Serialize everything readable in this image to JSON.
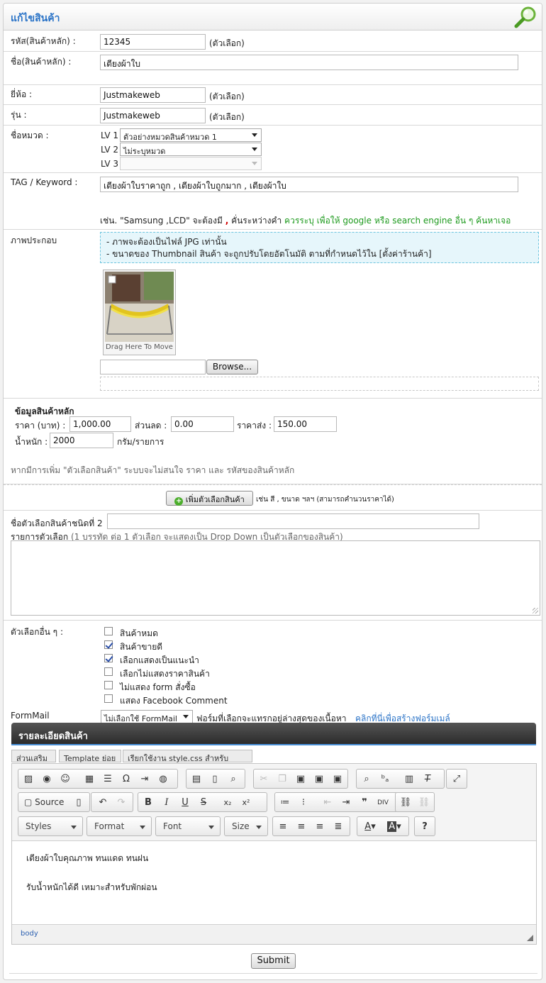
{
  "page": {
    "title": "แก้ไขสินค้า"
  },
  "product": {
    "code_label": "รหัส(สินค้าหลัก) :",
    "code_value": "12345",
    "optional": "(ตัวเลือก)",
    "name_label": "ชื่อ(สินค้าหลัก) :",
    "name_value": "เตียงผ้าใบ",
    "brand_label": "ยี่ห้อ :",
    "brand_value": "Justmakeweb",
    "model_label": "รุ่น :",
    "model_value": "Justmakeweb",
    "category_label": "ชื่อหมวด :",
    "lv1_label": "LV 1",
    "lv1_value": "ตัวอย่างหมวดสินค้าหมวด 1",
    "lv2_label": "LV 2",
    "lv2_value": "ไม่ระบุหมวด",
    "lv3_label": "LV 3",
    "lv3_value": "",
    "tag_label": "TAG / Keyword :",
    "tag_value": "เตียงผ้าใบราคาถูก , เตียงผ้าใบถูกมาก , เตียงผ้าใบ",
    "tag_hint_1": "เช่น. \"Samsung ,LCD\" จะต้องมี",
    "tag_hint_comma": ",",
    "tag_hint_2": "คั่นระหว่างคำ",
    "tag_hint_3": "ควรระบุ เพื่อให้ google หรือ search engine อื่น ๆ ค้นหาเจอ"
  },
  "image": {
    "label": "ภาพประกอบ",
    "info_1": "- ภาพจะต้องเป็นไฟล์ JPG เท่านั้น",
    "info_2": "- ขนาดของ Thumbnail สินค้า จะถูกปรับโดยอัตโนมัติ ตามที่กำหนดไว้ใน [ตั้งค่าร้านค้า]",
    "drag_caption": "Drag Here To Move",
    "file_value": "",
    "browse_label": "Browse..."
  },
  "main_data": {
    "heading": "ข้อมูลสินค้าหลัก",
    "price_label": "ราคา (บาท) :",
    "price_value": "1,000.00",
    "discount_label": "ส่วนลด :",
    "discount_value": "0.00",
    "wholesale_label": "ราคาส่ง :",
    "wholesale_value": "150.00",
    "weight_label": "น้ำหนัก :",
    "weight_value": "2000",
    "weight_unit": "กรัม/รายการ",
    "variant_note": "หากมีการเพิ่ม \"ตัวเลือกสินค้า\" ระบบจะไม่สนใจ ราคา และ รหัสของสินค้าหลัก"
  },
  "variants": {
    "add_button": "เพิ่มตัวเลือกสินค้า",
    "add_hint": "เช่น สี , ขนาด ฯลฯ (สามารถคำนวนราคาได้)",
    "type2_label": "ชื่อตัวเลือกสินค้าชนิดที่ 2",
    "type2_value": "",
    "list_label": "รายการตัวเลือก",
    "list_hint": "(1 บรรทัด ต่อ 1 ตัวเลือก จะแสดงเป็น Drop Down เป็นตัวเลือกของสินค้า)"
  },
  "other_options": {
    "label": "ตัวเลือกอื่น ๆ :",
    "items": [
      {
        "label": "สินค้าหมด",
        "checked": false
      },
      {
        "label": "สินค้าขายดี",
        "checked": true
      },
      {
        "label": "เลือกแสดงเป็นแนะนำ",
        "checked": true
      },
      {
        "label": "เลือกไม่แสดงราคาสินค้า",
        "checked": false
      },
      {
        "label": "ไม่แสดง form สั่งซื้อ",
        "checked": false
      },
      {
        "label": "แสดง Facebook Comment",
        "checked": false
      }
    ]
  },
  "formmail": {
    "label": "FormMail",
    "select_value": "ไม่เลือกใช้ FormMail",
    "hint": "ฟอร์มที่เลือกจะแทรกอยู่ล่างสุดของเนื้อหา",
    "link": "คลิกที่นี่เพื่อสร้างฟอร์มเมล์"
  },
  "editor": {
    "title": "รายละเอียดสินค้า",
    "tabs": [
      "ส่วนเสริม",
      "Template ย่อย",
      "เรียกใช้งาน style.css สำหรับ editor"
    ],
    "source_label": "Source",
    "combos": [
      "Styles",
      "Format",
      "Font",
      "Size"
    ],
    "content_1": "เตียงผ้าใบคุณภาพ ทนแดด ทนฝน",
    "content_2": "รับน้ำหนักได้ดี เหมาะสำหรับพักผ่อน",
    "path": "body"
  },
  "submit_label": "Submit"
}
